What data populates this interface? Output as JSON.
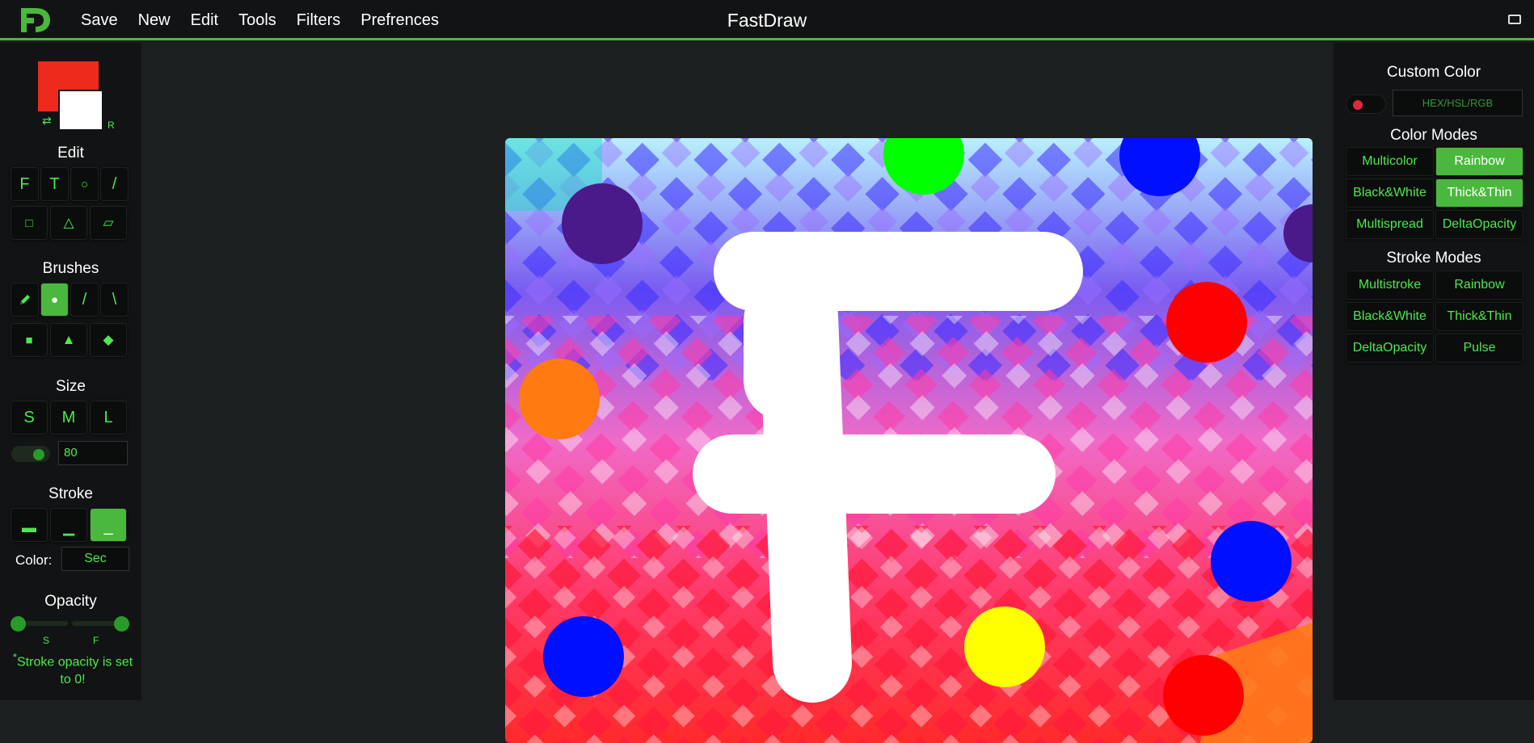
{
  "app": {
    "title": "FastDraw",
    "logo_text": "FD"
  },
  "menu": [
    "Save",
    "New",
    "Edit",
    "Tools",
    "Filters",
    "Prefrences"
  ],
  "left": {
    "colors": {
      "primary": "#ee2a1c",
      "secondary": "#ffffff",
      "swap_glyph": "⇄",
      "reset_label": "R"
    },
    "edit": {
      "title": "Edit",
      "tools": [
        "F",
        "T",
        "○",
        "/",
        "□",
        "△",
        "▱"
      ]
    },
    "brushes": {
      "title": "Brushes",
      "tools": [
        "pencil-icon",
        "●",
        "/",
        "\\",
        "■",
        "▲",
        "◆"
      ],
      "active_index": 1
    },
    "size": {
      "title": "Size",
      "options": [
        "S",
        "M",
        "L"
      ],
      "value": "80"
    },
    "stroke": {
      "title": "Stroke",
      "options": [
        "▬",
        "▁",
        "_"
      ],
      "active_index": 2,
      "color_label": "Color:",
      "color_value": "Sec"
    },
    "opacity": {
      "title": "Opacity",
      "tick_start": "S",
      "tick_end": "F",
      "note_star": "*",
      "note": "Stroke opacity is set to 0!"
    }
  },
  "right": {
    "custom_color": {
      "title": "Custom Color",
      "placeholder": "HEX/HSL/RGB",
      "dot_color": "#e0283a"
    },
    "color_modes": {
      "title": "Color Modes",
      "items": [
        {
          "label": "Multicolor",
          "active": false
        },
        {
          "label": "Rainbow",
          "active": true
        },
        {
          "label": "Black&White",
          "active": false
        },
        {
          "label": "Thick&Thin",
          "active": true
        },
        {
          "label": "Multispread",
          "active": false
        },
        {
          "label": "DeltaOpacity",
          "active": false
        }
      ]
    },
    "stroke_modes": {
      "title": "Stroke Modes",
      "items": [
        {
          "label": "Multistroke",
          "active": false
        },
        {
          "label": "Rainbow",
          "active": false
        },
        {
          "label": "Black&White",
          "active": false
        },
        {
          "label": "Thick&Thin",
          "active": false
        },
        {
          "label": "DeltaOpacity",
          "active": false
        },
        {
          "label": "Pulse",
          "active": false
        }
      ]
    }
  },
  "theme": {
    "accent": "#4ab83c",
    "text_green": "#4ee84e",
    "panel": "#121314",
    "background": "#1c1f20"
  }
}
